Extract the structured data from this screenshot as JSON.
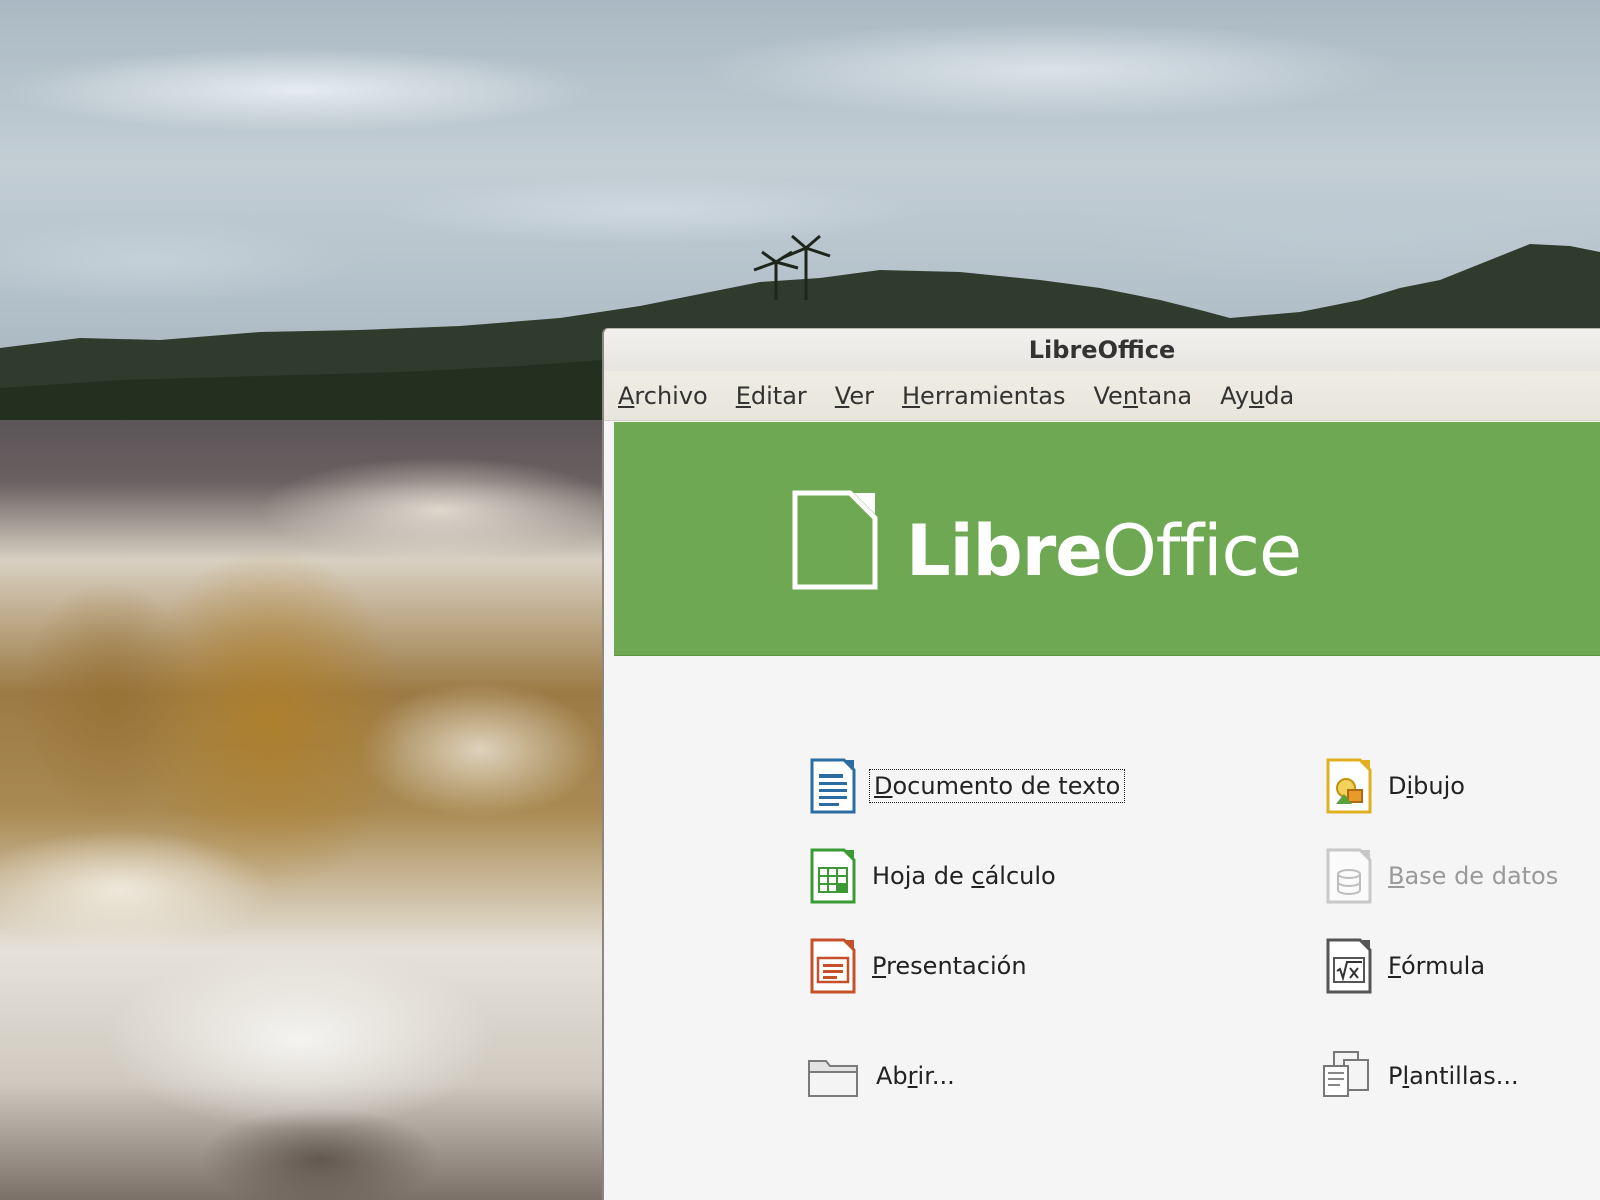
{
  "window": {
    "title": "LibreOffice"
  },
  "menu": [
    {
      "pre": "",
      "mn": "A",
      "post": "rchivo"
    },
    {
      "pre": "",
      "mn": "E",
      "post": "ditar"
    },
    {
      "pre": "",
      "mn": "V",
      "post": "er"
    },
    {
      "pre": "",
      "mn": "H",
      "post": "erramientas"
    },
    {
      "pre": "Ve",
      "mn": "n",
      "post": "tana"
    },
    {
      "pre": "Ay",
      "mn": "u",
      "post": "da"
    }
  ],
  "brand": {
    "libre": "Libre",
    "office": "Office"
  },
  "modules": {
    "writer": {
      "pre": "",
      "mn": "D",
      "post": "ocumento de texto",
      "focused": true
    },
    "calc": {
      "pre": "Hoja de ",
      "mn": "c",
      "post": "álculo"
    },
    "impress": {
      "pre": "",
      "mn": "P",
      "post": "resentación"
    },
    "open": {
      "pre": "Ab",
      "mn": "r",
      "post": "ir..."
    },
    "draw": {
      "pre": "D",
      "mn": "i",
      "post": "bujo"
    },
    "base": {
      "pre": "",
      "mn": "B",
      "post": "ase de datos",
      "disabled": true
    },
    "math": {
      "pre": "",
      "mn": "F",
      "post": "órmula"
    },
    "templates": {
      "pre": "P",
      "mn": "l",
      "post": "antillas..."
    }
  },
  "icons": {
    "writer": "writer-document-icon",
    "calc": "calc-spreadsheet-icon",
    "impress": "impress-presentation-icon",
    "open": "folder-icon",
    "draw": "draw-drawing-icon",
    "base": "base-database-icon",
    "math": "math-formula-icon",
    "templates": "templates-icon"
  },
  "colors": {
    "brand_green": "#6ea853",
    "writer_blue": "#2b6ca3",
    "calc_green": "#3c9a35",
    "impress_red": "#c5502a",
    "draw_yellow": "#e0b020",
    "math_gray": "#555555",
    "base_disabled": "#bdbdbd"
  }
}
